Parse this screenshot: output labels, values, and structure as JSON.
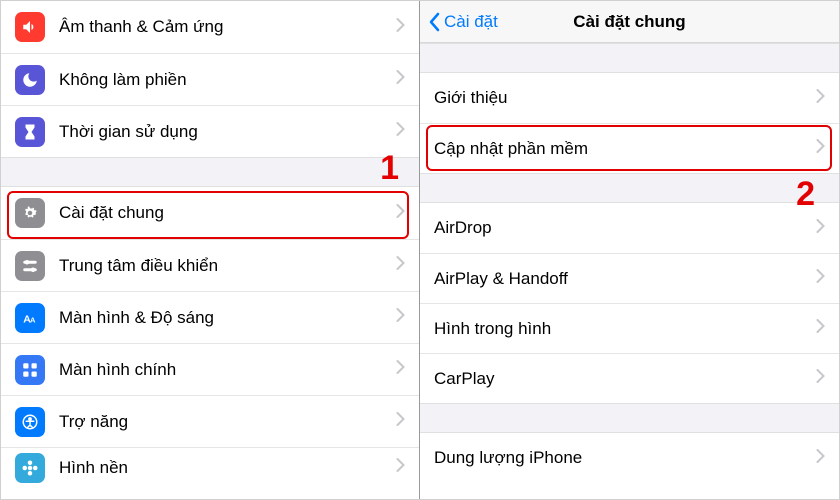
{
  "step1": "1",
  "step2": "2",
  "left": {
    "items": [
      {
        "label": "Âm thanh & Cảm ứng"
      },
      {
        "label": "Không làm phiền"
      },
      {
        "label": "Thời gian sử dụng"
      },
      {
        "label": "Cài đặt chung"
      },
      {
        "label": "Trung tâm điều khiển"
      },
      {
        "label": "Màn hình & Độ sáng"
      },
      {
        "label": "Màn hình chính"
      },
      {
        "label": "Trợ năng"
      },
      {
        "label": "Hình nền"
      }
    ]
  },
  "right": {
    "back": "Cài đặt",
    "title": "Cài đặt chung",
    "groups": {
      "g1": [
        {
          "label": "Giới thiệu"
        },
        {
          "label": "Cập nhật phần mềm"
        }
      ],
      "g2": [
        {
          "label": "AirDrop"
        },
        {
          "label": "AirPlay & Handoff"
        },
        {
          "label": "Hình trong hình"
        },
        {
          "label": "CarPlay"
        }
      ],
      "g3": [
        {
          "label": "Dung lượng iPhone"
        }
      ]
    }
  }
}
